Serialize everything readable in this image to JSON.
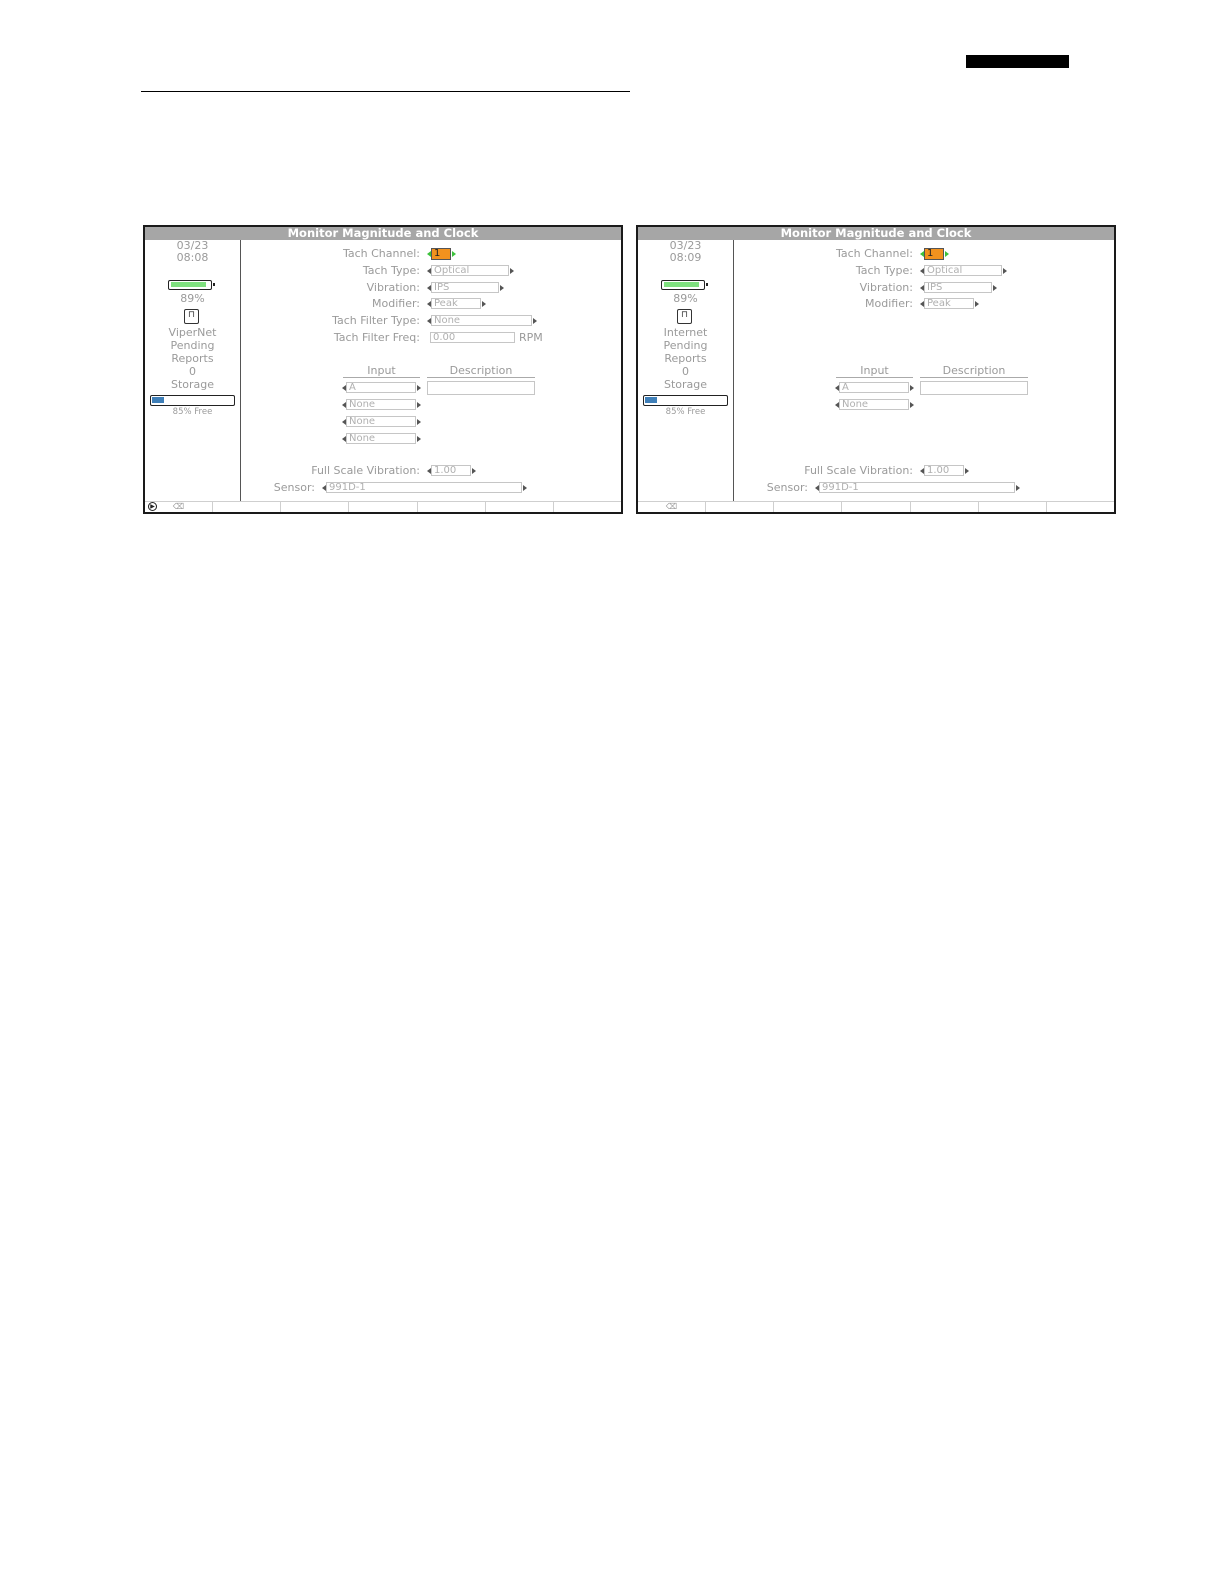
{
  "screens": [
    {
      "title": "Monitor Magnitude and Clock",
      "sidebar": {
        "date": "03/23",
        "time": "08:08",
        "battery_percent_label": "89%",
        "battery_level": 0.89,
        "network_icon": "ethernet-port-icon",
        "network_name": "ViperNet",
        "pending_line1": "Pending",
        "pending_line2": "Reports",
        "pending_count": "0",
        "storage_label": "Storage",
        "storage_used": 0.15,
        "storage_free": "85% Free",
        "record_icon": "play-circle-icon"
      },
      "form": {
        "tach_channel": {
          "label": "Tach Channel:",
          "value": "1"
        },
        "tach_type": {
          "label": "Tach Type:",
          "value": "Optical"
        },
        "vibration": {
          "label": "Vibration:",
          "value": "IPS"
        },
        "modifier": {
          "label": "Modifier:",
          "value": "Peak"
        },
        "tach_filter_type": {
          "label": "Tach Filter Type:",
          "value": "None"
        },
        "tach_filter_freq": {
          "label": "Tach Filter Freq:",
          "value": "0.00",
          "unit": "RPM"
        },
        "input_header": "Input",
        "description_header": "Description",
        "inputs": [
          "A",
          "None",
          "None",
          "None"
        ],
        "full_scale": {
          "label": "Full Scale Vibration:",
          "value": "1.00"
        },
        "sensor": {
          "label": "Sensor:",
          "value": "991D-1"
        }
      },
      "softkeys": [
        "⌫",
        "",
        "",
        "",
        "",
        "",
        ""
      ]
    },
    {
      "title": "Monitor Magnitude and Clock",
      "sidebar": {
        "date": "03/23",
        "time": "08:09",
        "battery_percent_label": "89%",
        "battery_level": 0.89,
        "network_icon": "ethernet-port-icon",
        "network_name": "Internet",
        "pending_line1": "Pending",
        "pending_line2": "Reports",
        "pending_count": "0",
        "storage_label": "Storage",
        "storage_used": 0.15,
        "storage_free": "85% Free"
      },
      "form": {
        "tach_channel": {
          "label": "Tach Channel:",
          "value": "1"
        },
        "tach_type": {
          "label": "Tach Type:",
          "value": "Optical"
        },
        "vibration": {
          "label": "Vibration:",
          "value": "IPS"
        },
        "modifier": {
          "label": "Modifier:",
          "value": "Peak"
        },
        "input_header": "Input",
        "description_header": "Description",
        "inputs": [
          "A",
          "None"
        ],
        "full_scale": {
          "label": "Full Scale Vibration:",
          "value": "1.00"
        },
        "sensor": {
          "label": "Sensor:",
          "value": "991D-1"
        }
      },
      "softkeys": [
        "⌫",
        "",
        "",
        "",
        "",
        "",
        ""
      ]
    }
  ]
}
